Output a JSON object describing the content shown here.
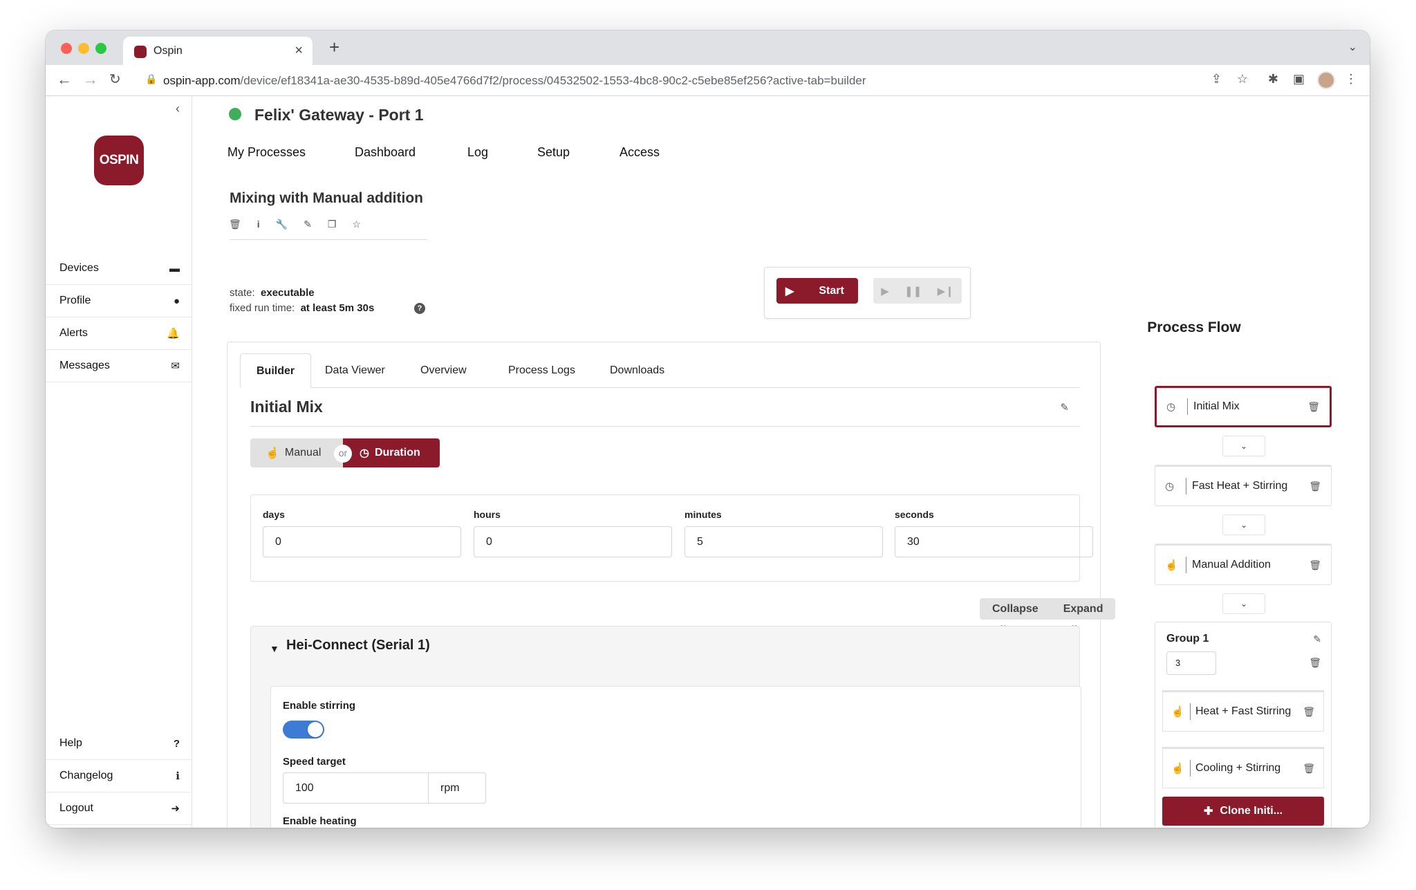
{
  "browser": {
    "tab_title": "Ospin",
    "url_host": "ospin-app.com",
    "url_path": "/device/ef18341a-ae30-4535-b89d-405e4766d7f2/process/04532502-1553-4bc8-90c2-c5ebe85ef256?active-tab=builder",
    "tab_close": "×",
    "new_tab": "+"
  },
  "sidebar": {
    "logo_text": "OSPIN",
    "collapse_glyph": "‹",
    "items": [
      {
        "label": "Devices",
        "icon": "hdd-icon",
        "glyph": "▬"
      },
      {
        "label": "Profile",
        "icon": "user-icon",
        "glyph": "●"
      },
      {
        "label": "Alerts",
        "icon": "bell-icon",
        "glyph": "🔔"
      },
      {
        "label": "Messages",
        "icon": "envelope-icon",
        "glyph": "✉"
      }
    ],
    "bottom_items": [
      {
        "label": "Help",
        "icon": "question-icon",
        "glyph": "?"
      },
      {
        "label": "Changelog",
        "icon": "info-icon",
        "glyph": "ℹ"
      },
      {
        "label": "Logout",
        "icon": "logout-icon",
        "glyph": "➜"
      }
    ]
  },
  "header": {
    "device_title": "Felix' Gateway - Port 1",
    "status_color": "#3fae5a",
    "nav": [
      "My Processes",
      "Dashboard",
      "Log",
      "Setup",
      "Access"
    ]
  },
  "process": {
    "title": "Mixing with Manual addition",
    "state_label": "state:",
    "state_value": "executable",
    "runtime_label": "fixed run time:",
    "runtime_value": "at least 5m 30s",
    "help_glyph": "?"
  },
  "controls": {
    "start_label": "Start"
  },
  "tabs": [
    "Builder",
    "Data Viewer",
    "Overview",
    "Process Logs",
    "Downloads"
  ],
  "step": {
    "title": "Initial Mix",
    "manual_label": "Manual",
    "or_label": "or",
    "duration_label": "Duration",
    "duration": [
      {
        "label": "days",
        "value": "0"
      },
      {
        "label": "hours",
        "value": "0"
      },
      {
        "label": "minutes",
        "value": "5"
      },
      {
        "label": "seconds",
        "value": "30"
      }
    ],
    "collapse_all": "Collapse All",
    "expand_all": "Expand All"
  },
  "device_section": {
    "title": "Hei-Connect (Serial 1)",
    "enable_stirring_label": "Enable stirring",
    "enable_stirring": true,
    "speed_target_label": "Speed target",
    "speed_target_value": "100",
    "speed_unit": "rpm",
    "enable_heating_label": "Enable heating",
    "enable_heating": true
  },
  "flow": {
    "title": "Process Flow",
    "steps": [
      {
        "label": "Initial Mix",
        "type": "duration",
        "active": true
      },
      {
        "label": "Fast Heat + Stirring",
        "type": "duration",
        "active": false
      },
      {
        "label": "Manual Addition",
        "type": "manual",
        "active": false
      }
    ],
    "group": {
      "title": "Group 1",
      "iterations": "3",
      "steps": [
        {
          "label": "Heat + Fast Stirring",
          "type": "manual"
        },
        {
          "label": "Cooling + Stirring",
          "type": "manual"
        }
      ]
    },
    "clone_label": "Clone Initi..."
  },
  "colors": {
    "brand": "#8b1a2b",
    "toggle_on": "#3d7bd4"
  }
}
